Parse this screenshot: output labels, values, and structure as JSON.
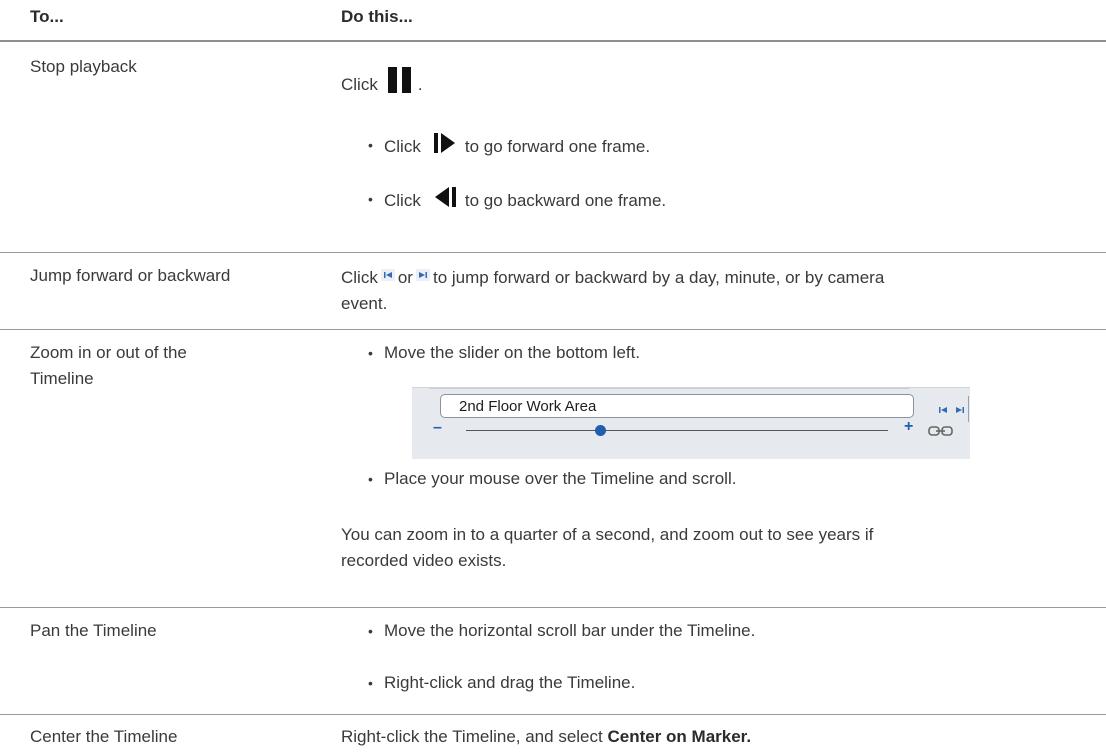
{
  "header": {
    "col1": "To...",
    "col2": "Do this..."
  },
  "rows": {
    "stop": {
      "to": "Stop playback",
      "click": "Click",
      "after": ".",
      "fwd_click": "Click",
      "fwd_text": "to go forward one frame.",
      "back_click": "Click",
      "back_text": "to go backward one frame."
    },
    "jump": {
      "to": "Jump forward or backward",
      "click": "Click",
      "or": "or",
      "text1": "to jump forward or backward by a day, minute, or by camera",
      "text2": "event."
    },
    "zoom": {
      "to1": "Zoom in or out of the",
      "to2": "Timeline",
      "bullet1": "Move the slider on the bottom left.",
      "shot_field": "2nd Floor Work Area",
      "bullet2": "Place your mouse over the Timeline and scroll.",
      "note1": "You can zoom in to a quarter of a second, and zoom out to see years if",
      "note2": "recorded video exists."
    },
    "pan": {
      "to": "Pan the Timeline",
      "bullet1": "Move the horizontal scroll bar under the Timeline.",
      "bullet2": "Right-click and drag the Timeline."
    },
    "center": {
      "to": "Center the Timeline",
      "text": "Right-click the Timeline, and select",
      "bold": "Center on Marker."
    }
  },
  "colors": {
    "accent": "#1f5fae",
    "text": "#3a3a3a",
    "rule": "#9a9a9a"
  },
  "icons": [
    "pause-icon",
    "step-forward-icon",
    "step-backward-icon",
    "jump-start-icon",
    "jump-end-icon",
    "link-icon"
  ]
}
